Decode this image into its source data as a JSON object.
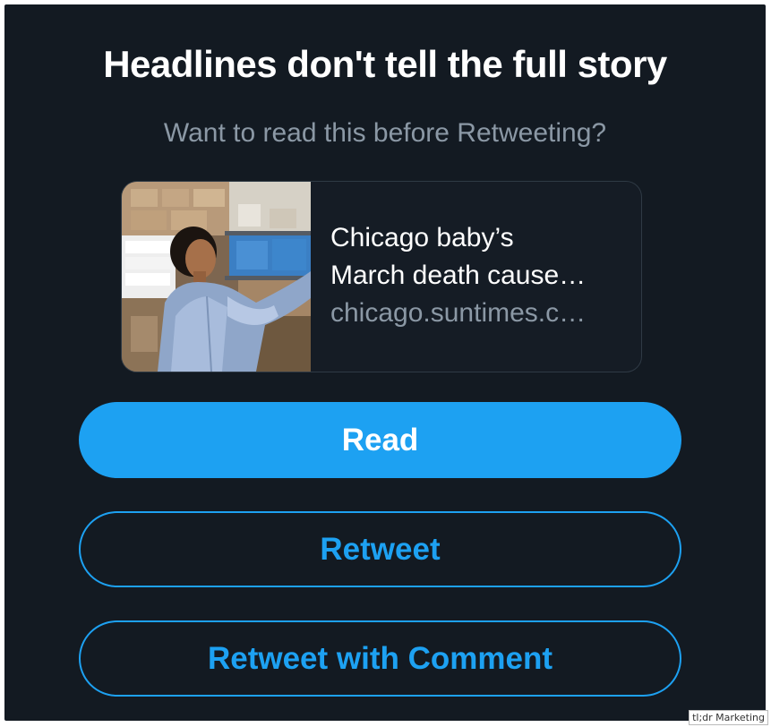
{
  "prompt": {
    "headline": "Headlines don't tell the full story",
    "subheadline": "Want to read this before Retweeting?"
  },
  "article_card": {
    "title": "Chicago baby’s March death cause…",
    "title_line1": "Chicago baby’s",
    "title_line2": "March death cause…",
    "domain": "chicago.suntimes.c…",
    "thumbnail_icon": "article-photo"
  },
  "actions": {
    "read_label": "Read",
    "retweet_label": "Retweet",
    "retweet_with_comment_label": "Retweet with Comment"
  },
  "watermark": "tl;dr Marketing",
  "colors": {
    "background": "#131a22",
    "accent": "#1da1f2",
    "secondary_text": "#8b98a5"
  }
}
